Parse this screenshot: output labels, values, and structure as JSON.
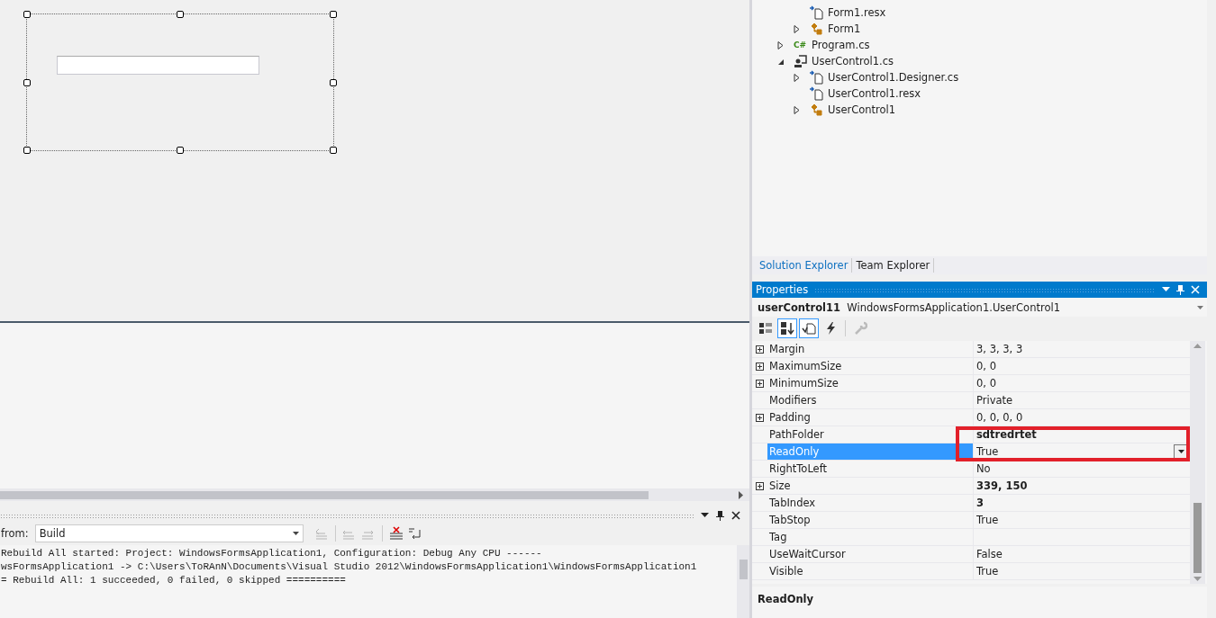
{
  "solution_explorer": {
    "partial_items": [
      {
        "label": "Form1.resx",
        "kind": "resx",
        "has_children": false
      },
      {
        "label": "Form1",
        "kind": "class",
        "has_children": true,
        "expanded": false
      }
    ],
    "items": [
      {
        "label": "Program.cs",
        "kind": "csharp",
        "icon_text": "C#",
        "has_children": true,
        "expanded": false
      },
      {
        "label": "UserControl1.cs",
        "kind": "usercontrol",
        "has_children": true,
        "expanded": true,
        "children": [
          {
            "label": "UserControl1.Designer.cs",
            "kind": "resx",
            "has_children": true,
            "expanded": false
          },
          {
            "label": "UserControl1.resx",
            "kind": "resx",
            "has_children": false
          },
          {
            "label": "UserControl1",
            "kind": "class",
            "has_children": true,
            "expanded": false
          }
        ]
      }
    ]
  },
  "tabs": [
    {
      "label": "Solution Explorer",
      "selected": true
    },
    {
      "label": "Team Explorer",
      "selected": false
    }
  ],
  "properties": {
    "title": "Properties",
    "object_name": "userControl11",
    "object_type": "WindowsFormsApplication1.UserControl1",
    "toolbar": [
      {
        "kind": "categorized",
        "selected": false,
        "disabled": false
      },
      {
        "kind": "alphabetical",
        "selected": true,
        "disabled": false
      },
      {
        "kind": "properties",
        "selected": true,
        "disabled": false
      },
      {
        "kind": "events",
        "selected": false,
        "disabled": false
      },
      {
        "kind": "pages",
        "selected": false,
        "disabled": true
      }
    ],
    "rows": [
      {
        "name": "Margin",
        "value": "3, 3, 3, 3",
        "expandable": true,
        "bold": false,
        "selected": false
      },
      {
        "name": "MaximumSize",
        "value": "0, 0",
        "expandable": true,
        "bold": false,
        "selected": false
      },
      {
        "name": "MinimumSize",
        "value": "0, 0",
        "expandable": true,
        "bold": false,
        "selected": false
      },
      {
        "name": "Modifiers",
        "value": "Private",
        "expandable": false,
        "bold": false,
        "selected": false
      },
      {
        "name": "Padding",
        "value": "0, 0, 0, 0",
        "expandable": true,
        "bold": false,
        "selected": false
      },
      {
        "name": "PathFolder",
        "value": "sdtredrtet",
        "expandable": false,
        "bold": true,
        "selected": false
      },
      {
        "name": "ReadOnly",
        "value": "True",
        "expandable": false,
        "bold": false,
        "selected": true
      },
      {
        "name": "RightToLeft",
        "value": "No",
        "expandable": false,
        "bold": false,
        "selected": false
      },
      {
        "name": "Size",
        "value": "339, 150",
        "expandable": true,
        "bold": true,
        "selected": false
      },
      {
        "name": "TabIndex",
        "value": "3",
        "expandable": false,
        "bold": true,
        "selected": false
      },
      {
        "name": "TabStop",
        "value": "True",
        "expandable": false,
        "bold": false,
        "selected": false
      },
      {
        "name": "Tag",
        "expandable": false,
        "selected": false
      },
      {
        "name": "UseWaitCursor",
        "value": "False",
        "expandable": false,
        "bold": false,
        "selected": false
      },
      {
        "name": "Visible",
        "value": "True",
        "expandable": false,
        "bold": false,
        "selected": false
      }
    ],
    "description": "ReadOnly"
  },
  "output": {
    "source_label": "from:",
    "source": "Build",
    "toolbar": [
      {
        "kind": "find",
        "disabled": true
      },
      {
        "kind": "prev",
        "disabled": true
      },
      {
        "kind": "next",
        "disabled": true
      },
      {
        "kind": "clear",
        "disabled": false
      },
      {
        "kind": "wrap",
        "disabled": false
      }
    ],
    "lines": [
      "Rebuild All started: Project: WindowsFormsApplication1, Configuration: Debug Any CPU ------",
      "wsFormsApplication1 -> C:\\Users\\ToRAnN\\Documents\\Visual Studio 2012\\WindowsFormsApplication1\\WindowsFormsApplication1",
      "= Rebuild All: 1 succeeded, 0 failed, 0 skipped =========="
    ]
  }
}
